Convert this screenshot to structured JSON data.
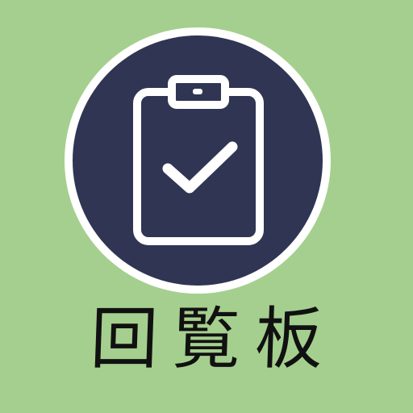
{
  "app": {
    "name": "回覧板",
    "icon": "clipboard-check-icon"
  },
  "colors": {
    "background": "#a5cf8e",
    "badge_ring": "#ffffff",
    "badge_fill": "#2f3553",
    "title_text": "#111111"
  }
}
